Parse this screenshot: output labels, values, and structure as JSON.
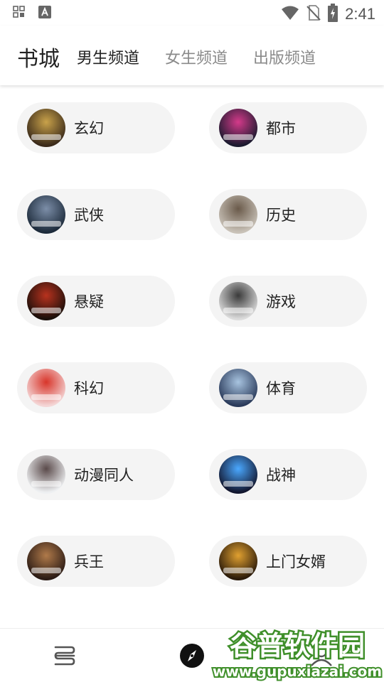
{
  "status_bar": {
    "time": "2:41",
    "icons": [
      "grid-icon",
      "font-a-icon",
      "wifi-icon",
      "no-sim-icon",
      "battery-charging-icon"
    ]
  },
  "header": {
    "title": "书城",
    "tabs": [
      {
        "label": "男生频道",
        "active": true
      },
      {
        "label": "女生频道",
        "active": false
      },
      {
        "label": "出版频道",
        "active": false
      }
    ]
  },
  "categories": [
    {
      "label": "玄幻",
      "cover_icon": "book-cover-xuanhuan",
      "cover_colors": [
        "#3a2a1a",
        "#c9a24a"
      ]
    },
    {
      "label": "都市",
      "cover_icon": "book-cover-dushi",
      "cover_colors": [
        "#1a1a2e",
        "#d43a8a"
      ]
    },
    {
      "label": "武侠",
      "cover_icon": "book-cover-wuxia",
      "cover_colors": [
        "#1c2a3a",
        "#7c8ea8"
      ]
    },
    {
      "label": "历史",
      "cover_icon": "book-cover-lishi",
      "cover_colors": [
        "#c9c2b8",
        "#6a5a4a"
      ]
    },
    {
      "label": "悬疑",
      "cover_icon": "book-cover-xuanyi",
      "cover_colors": [
        "#1a0f0a",
        "#b8321e"
      ]
    },
    {
      "label": "游戏",
      "cover_icon": "book-cover-youxi",
      "cover_colors": [
        "#dcdcdc",
        "#3a3a3a"
      ]
    },
    {
      "label": "科幻",
      "cover_icon": "book-cover-kehuan",
      "cover_colors": [
        "#f4d6d6",
        "#d8352a"
      ]
    },
    {
      "label": "体育",
      "cover_icon": "book-cover-tiyu",
      "cover_colors": [
        "#2a3a5a",
        "#a8c4e0"
      ]
    },
    {
      "label": "动漫同人",
      "cover_icon": "book-cover-dongman",
      "cover_colors": [
        "#eef0f2",
        "#5a4a4a"
      ]
    },
    {
      "label": "战神",
      "cover_icon": "book-cover-zhanshen",
      "cover_colors": [
        "#12162e",
        "#4aa8ff"
      ]
    },
    {
      "label": "兵王",
      "cover_icon": "book-cover-bingwang",
      "cover_colors": [
        "#2a1a14",
        "#b07a4a"
      ]
    },
    {
      "label": "上门女婿",
      "cover_icon": "book-cover-shangmen",
      "cover_colors": [
        "#2a1a0a",
        "#e0a030"
      ]
    }
  ],
  "bottom_nav": {
    "items": [
      {
        "icon": "bookshelf-icon"
      },
      {
        "icon": "compass-icon"
      },
      {
        "icon": "profile-icon"
      }
    ]
  },
  "watermark": {
    "title": "谷普软件园",
    "url": "www.gupuxiazai.com"
  },
  "colors": {
    "pill_bg": "#f4f4f4",
    "active_tab": "#222222",
    "inactive_tab": "#8a8a8a",
    "watermark_green": "#3f8f2a"
  }
}
